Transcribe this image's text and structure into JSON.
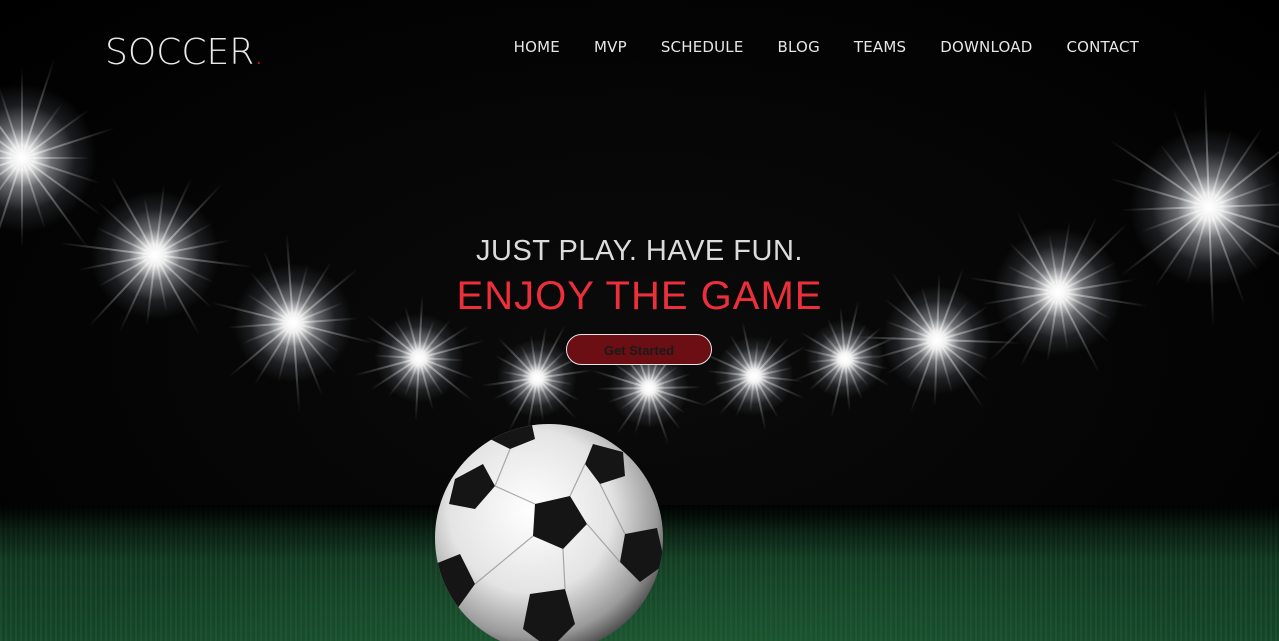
{
  "brand": {
    "logo_text": "SOCCER",
    "logo_dot": ".",
    "accent_color": "#c0121e"
  },
  "nav": {
    "items": [
      {
        "label": "HOME"
      },
      {
        "label": "MVP"
      },
      {
        "label": "SCHEDULE"
      },
      {
        "label": "BLOG"
      },
      {
        "label": "TEAMS"
      },
      {
        "label": "DOWNLOAD"
      },
      {
        "label": "CONTACT"
      }
    ]
  },
  "hero": {
    "tagline": "JUST PLAY. HAVE FUN.",
    "headline": "ENJOY THE GAME",
    "headline_color": "#ec2f3a",
    "cta_label": "Get Started",
    "cta_color": "#6b0f14"
  }
}
